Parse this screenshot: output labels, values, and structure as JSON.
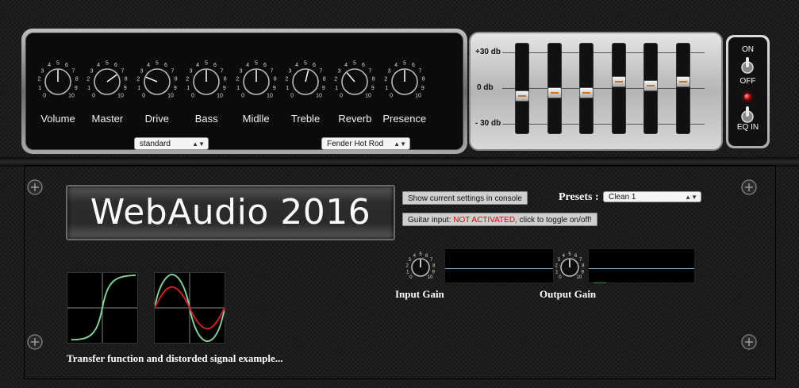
{
  "knobs": [
    {
      "label": "Volume",
      "value": 5
    },
    {
      "label": "Master",
      "value": 7
    },
    {
      "label": "Drive",
      "value": 2.5
    },
    {
      "label": "Bass",
      "value": 5
    },
    {
      "label": "Midlle",
      "value": 5
    },
    {
      "label": "Treble",
      "value": 5.5
    },
    {
      "label": "Reverb",
      "value": 3.5
    },
    {
      "label": "Presence",
      "value": 5
    }
  ],
  "dial_scale": [
    "0",
    "1",
    "2",
    "3",
    "4",
    "5",
    "6",
    "7",
    "8",
    "9",
    "10"
  ],
  "amp_select": {
    "value": "standard"
  },
  "cabinet_select": {
    "value": "Fender Hot Rod"
  },
  "eq": {
    "labels": {
      "top": "+30 db",
      "mid": "0 db",
      "bottom": "- 30 db"
    },
    "bands": [
      -2,
      -1,
      -1,
      2,
      1,
      2
    ]
  },
  "power": {
    "on_label": "ON",
    "off_label": "OFF",
    "eq_label": "EQ IN",
    "led_color": "#ff0000"
  },
  "title": "WebAudio 2016",
  "buttons": {
    "show_settings": "Show current settings in console",
    "guitar_input_prefix": "Guitar input: ",
    "guitar_input_status": "NOT ACTIVATED",
    "guitar_input_suffix": ", click to toggle on/off!"
  },
  "presets": {
    "label": "Presets :",
    "value": "Clean 1"
  },
  "input_gain": {
    "label": "Input Gain",
    "value": 5
  },
  "output_gain": {
    "label": "Output Gain",
    "value": 5
  },
  "caption": "Transfer function and distorded signal example..."
}
